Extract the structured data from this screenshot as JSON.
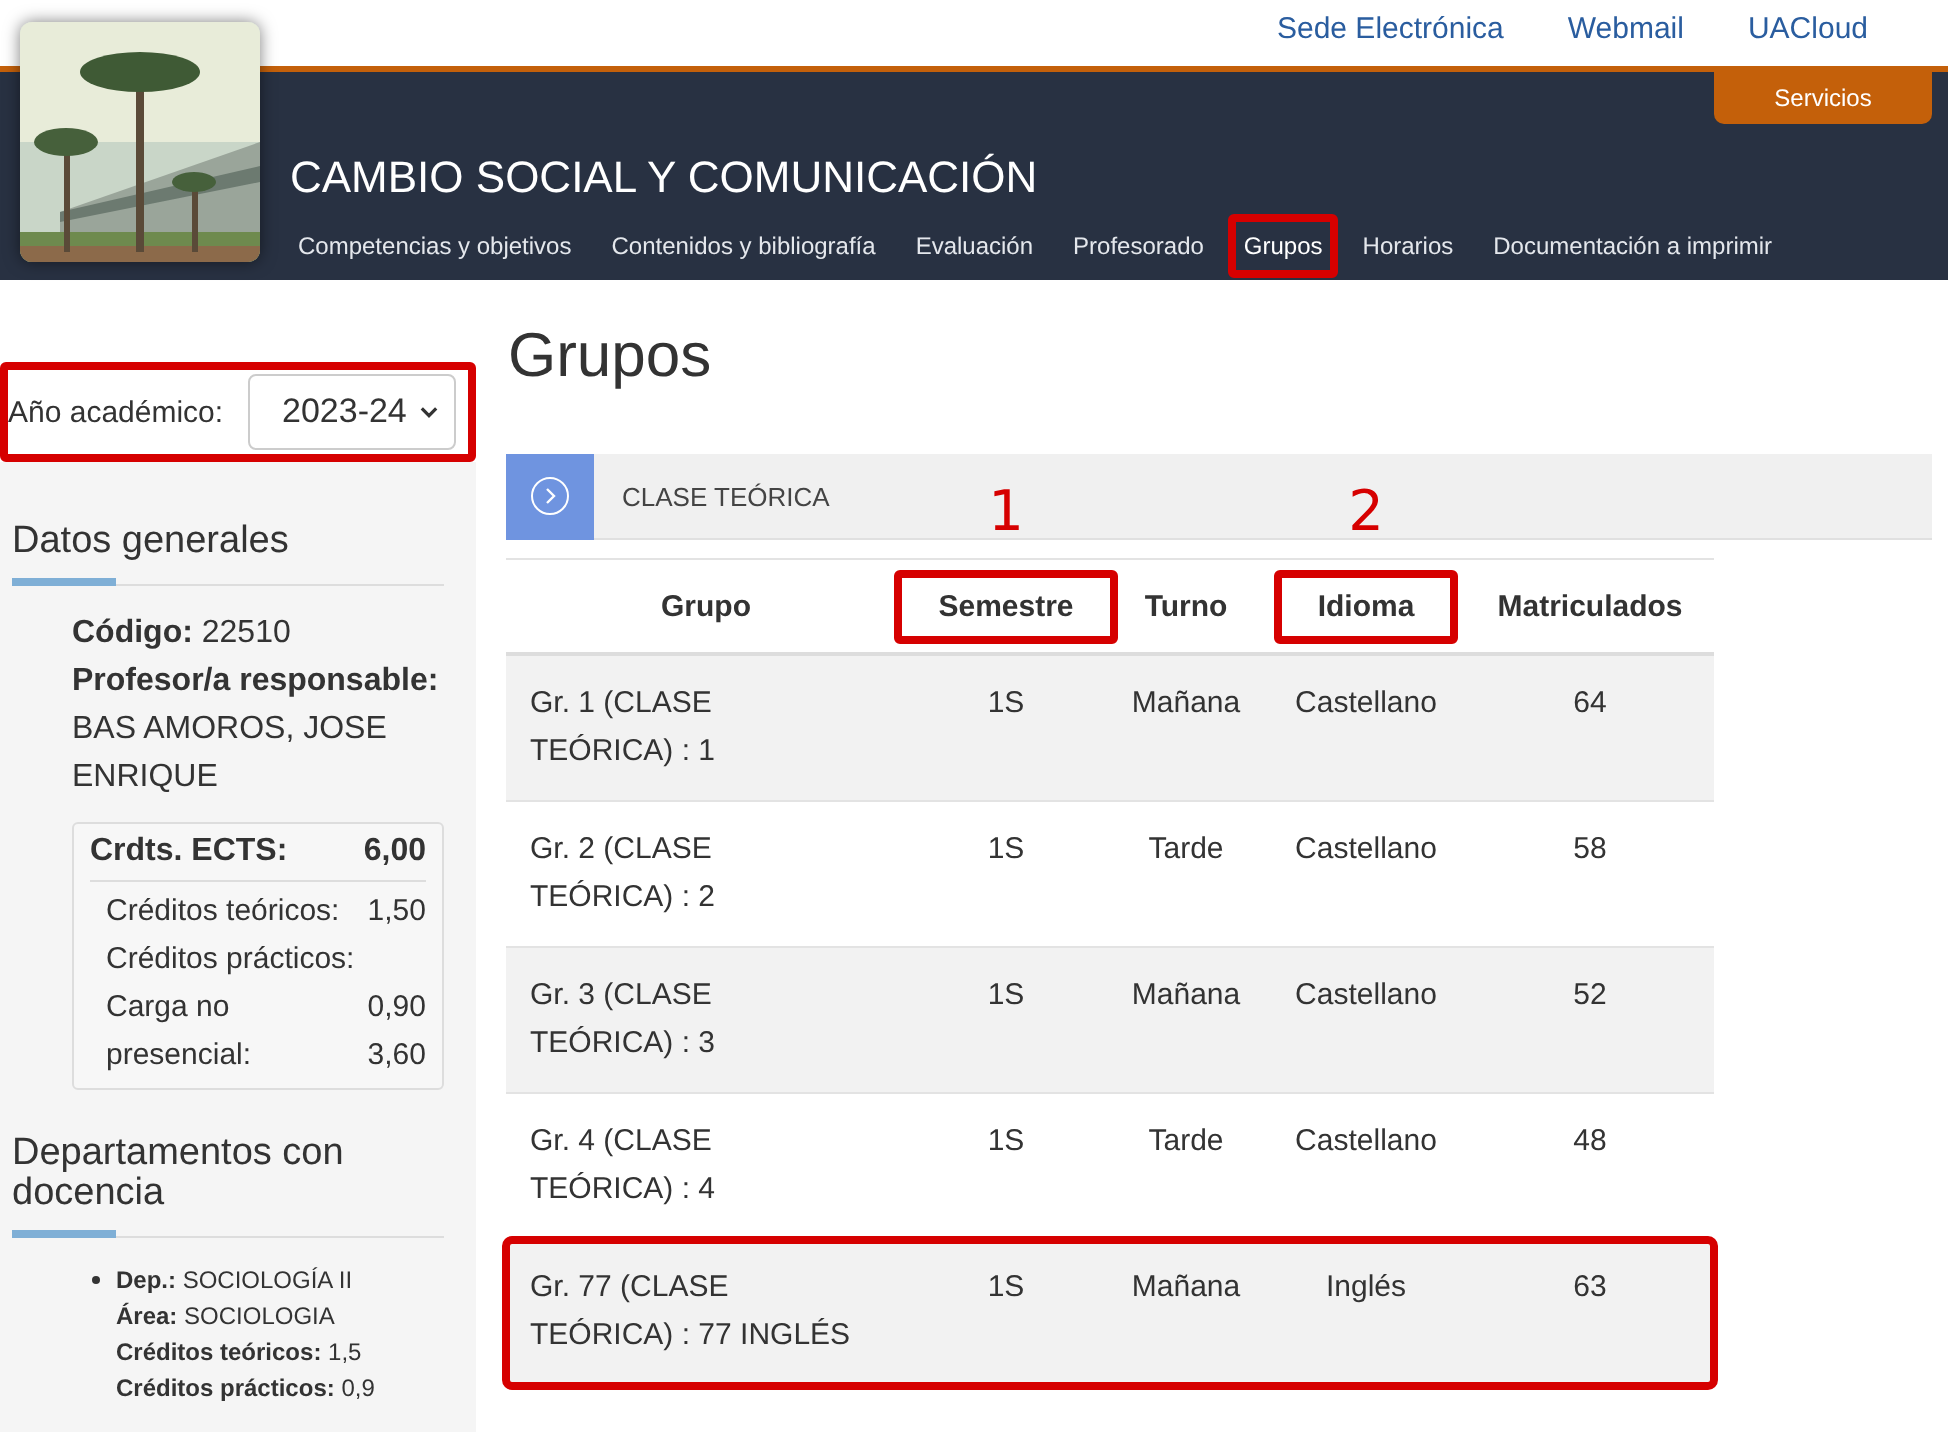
{
  "top_links": [
    "Sede Electrónica",
    "Webmail",
    "UACloud"
  ],
  "services_button": "Servicios",
  "course_title": "CAMBIO SOCIAL Y COMUNICACIÓN",
  "nav": [
    {
      "label": "Competencias y objetivos",
      "selected": false,
      "highlighted": false
    },
    {
      "label": "Contenidos y bibliografía",
      "selected": false,
      "highlighted": false
    },
    {
      "label": "Evaluación",
      "selected": false,
      "highlighted": false
    },
    {
      "label": "Profesorado",
      "selected": false,
      "highlighted": false
    },
    {
      "label": "Grupos",
      "selected": true,
      "highlighted": true
    },
    {
      "label": "Horarios",
      "selected": false,
      "highlighted": false
    },
    {
      "label": "Documentación a imprimir",
      "selected": false,
      "highlighted": false
    }
  ],
  "year_selector": {
    "label": "Año académico:",
    "value": "2023-24",
    "highlighted": true
  },
  "sidebar": {
    "general": {
      "heading": "Datos generales",
      "code": "**Código:** 22510",
      "responsible_label": "Profesor/a responsable:",
      "responsible": "BAS AMOROS, JOSE ENRIQUE",
      "ects": {
        "label": "Crdts. ECTS:",
        "value": "6,00",
        "rows": [
          {
            "label": "Créditos teóricos:",
            "value": "1,50"
          },
          {
            "label": "Créditos prácticos:",
            "value": "0,90"
          },
          {
            "label": "Carga no presencial:",
            "value": "3,60"
          }
        ]
      }
    },
    "departments": {
      "heading": "Departamentos con docencia",
      "items": [
        {
          "lines": [
            "**Dep.:** SOCIOLOGÍA II",
            "**Área:** SOCIOLOGIA",
            "**Créditos teóricos:** 1,5",
            "**Créditos prácticos:** 0,9"
          ]
        }
      ]
    }
  },
  "page_title": "Grupos",
  "section": {
    "title": "CLASE TEÓRICA",
    "expanded": false
  },
  "table": {
    "columns": [
      {
        "label": "Grupo",
        "highlighted": false
      },
      {
        "label": "Semestre",
        "highlighted": true,
        "marker": "1"
      },
      {
        "label": "Turno",
        "highlighted": false
      },
      {
        "label": "Idioma",
        "highlighted": true,
        "marker": "2"
      },
      {
        "label": "Matriculados",
        "highlighted": false
      }
    ],
    "rows": [
      {
        "cells": [
          "Gr. 1 (CLASE TEÓRICA) : 1",
          "1S",
          "Mañana",
          "Castellano",
          "64"
        ],
        "highlighted": false
      },
      {
        "cells": [
          "Gr. 2 (CLASE TEÓRICA) : 2",
          "1S",
          "Tarde",
          "Castellano",
          "58"
        ],
        "highlighted": false
      },
      {
        "cells": [
          "Gr. 3 (CLASE TEÓRICA) : 3",
          "1S",
          "Mañana",
          "Castellano",
          "52"
        ],
        "highlighted": false
      },
      {
        "cells": [
          "Gr. 4 (CLASE TEÓRICA) : 4",
          "1S",
          "Tarde",
          "Castellano",
          "48"
        ],
        "highlighted": false
      },
      {
        "cells": [
          "Gr. 77 (CLASE TEÓRICA) : 77 INGLÉS",
          "1S",
          "Mañana",
          "Inglés",
          "63"
        ],
        "highlighted": true
      }
    ]
  }
}
